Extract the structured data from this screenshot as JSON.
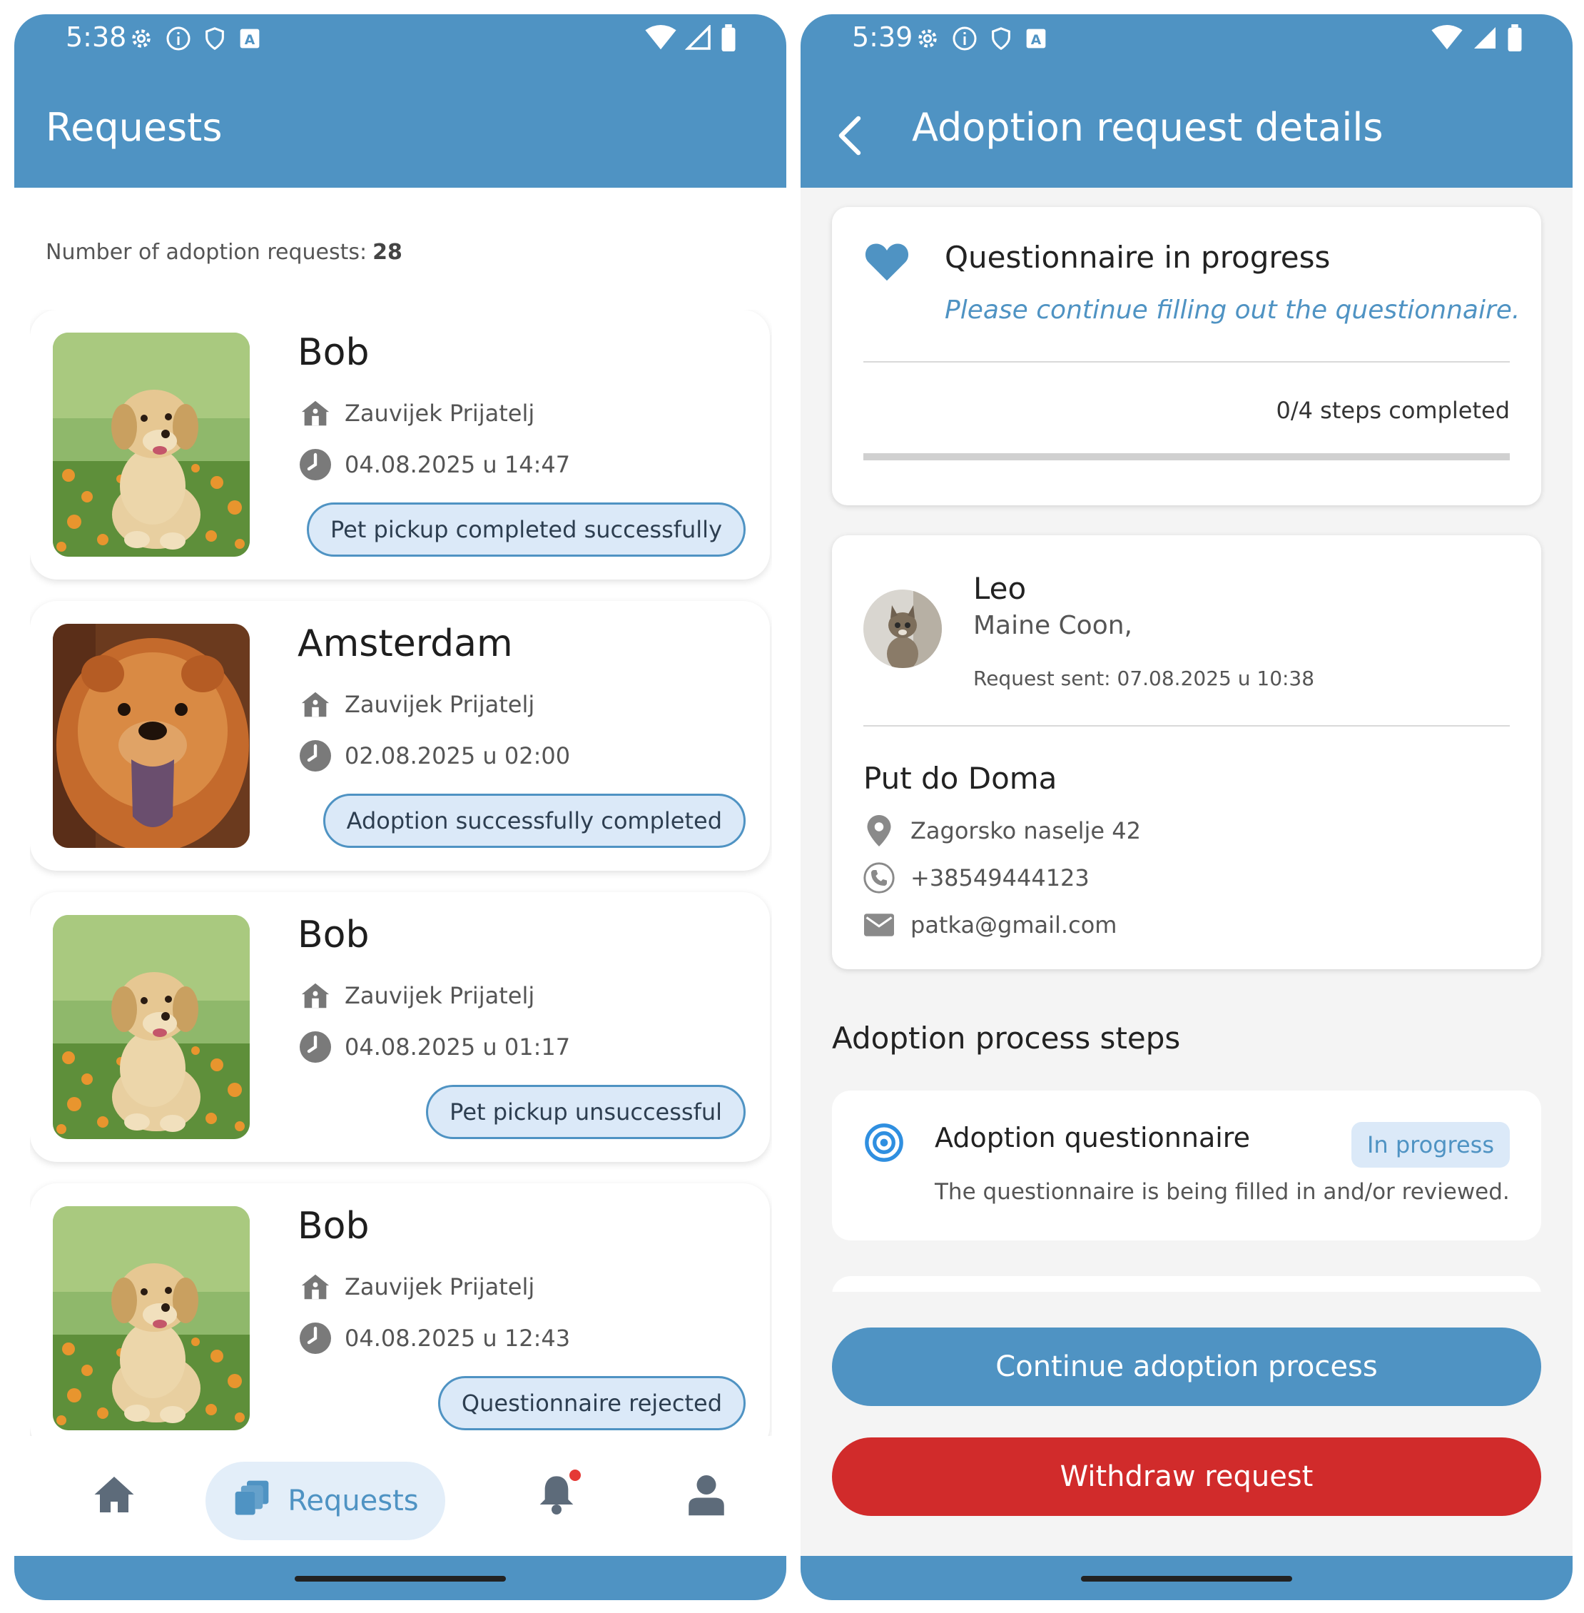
{
  "left": {
    "status": {
      "time": "5:38"
    },
    "appbar": {
      "title": "Requests"
    },
    "count": {
      "label": "Number of adoption requests:",
      "value": "28"
    },
    "requests": [
      {
        "name": "Bob",
        "shelter": "Zauvijek Prijatelj",
        "date": "04.08.2025 u 14:47",
        "status": "Pet pickup completed successfully",
        "photo": "golden-retriever-puppy"
      },
      {
        "name": "Amsterdam",
        "shelter": "Zauvijek Prijatelj",
        "date": "02.08.2025 u 02:00",
        "status": "Adoption successfully completed",
        "photo": "chow-chow"
      },
      {
        "name": "Bob",
        "shelter": "Zauvijek Prijatelj",
        "date": "04.08.2025 u 01:17",
        "status": "Pet pickup unsuccessful",
        "photo": "golden-retriever-puppy"
      },
      {
        "name": "Bob",
        "shelter": "Zauvijek Prijatelj",
        "date": "04.08.2025 u 12:43",
        "status": "Questionnaire rejected",
        "photo": "golden-retriever-puppy"
      }
    ],
    "nav": {
      "requests_label": "Requests"
    }
  },
  "right": {
    "status": {
      "time": "5:39"
    },
    "appbar": {
      "title": "Adoption request details"
    },
    "questionnaire": {
      "title": "Questionnaire in progress",
      "subtitle": "Please continue filling out the questionnaire.",
      "steps_text": "0/4 steps completed",
      "progress": 0
    },
    "pet": {
      "name": "Leo",
      "breed": "Maine Coon,",
      "sent": "Request sent: 07.08.2025 u 10:38"
    },
    "shelter": {
      "name": "Put do Doma",
      "address": "Zagorsko naselje 42",
      "phone": "+38549444123",
      "email": "patka@gmail.com"
    },
    "steps_section": {
      "title": "Adoption process steps"
    },
    "step": {
      "title": "Adoption questionnaire",
      "badge": "In progress",
      "desc": "The questionnaire is being filled in and/or reviewed."
    },
    "buttons": {
      "continue": "Continue adoption process",
      "withdraw": "Withdraw request"
    }
  },
  "colors": {
    "primary": "#4f93c3",
    "danger": "#d12b2b",
    "pill_bg": "#dbe9f8"
  }
}
